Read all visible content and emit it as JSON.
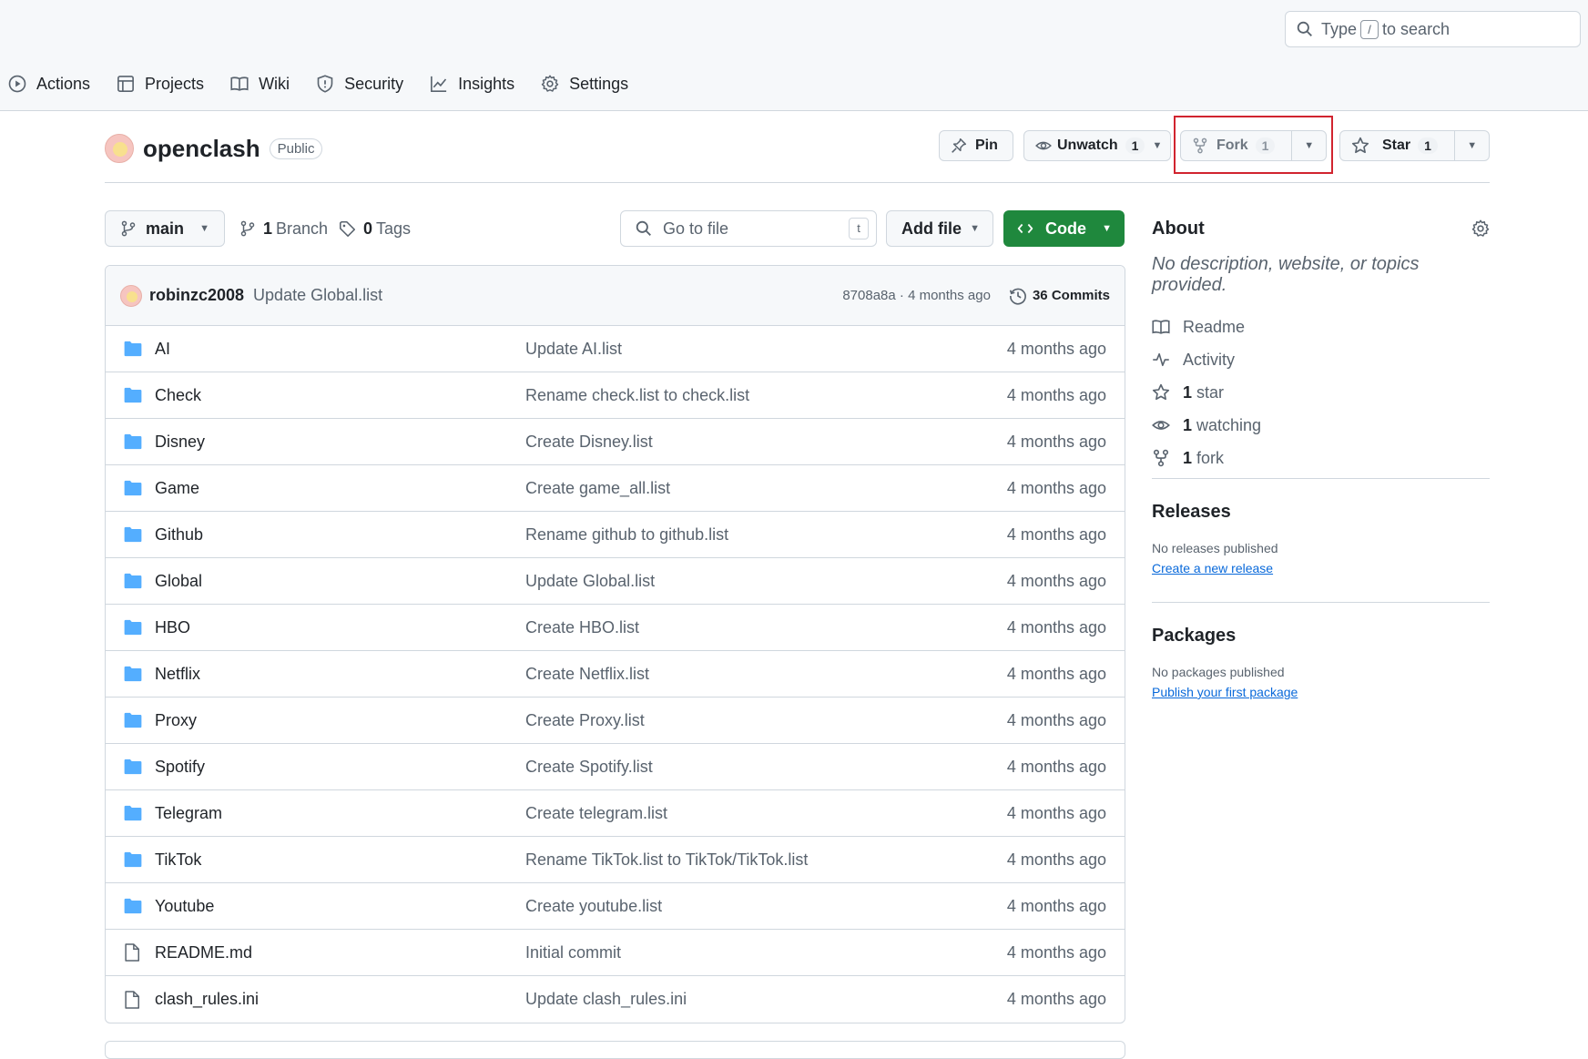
{
  "search": {
    "prefix": "Type",
    "key": "/",
    "suffix": "to search"
  },
  "nav": {
    "tabs": [
      {
        "label": "Actions",
        "icon": "play-icon"
      },
      {
        "label": "Projects",
        "icon": "table-icon"
      },
      {
        "label": "Wiki",
        "icon": "book-icon"
      },
      {
        "label": "Security",
        "icon": "shield-icon"
      },
      {
        "label": "Insights",
        "icon": "graph-icon"
      },
      {
        "label": "Settings",
        "icon": "gear-icon"
      }
    ]
  },
  "repo": {
    "name": "openclash",
    "visibility": "Public"
  },
  "actions": {
    "pin": "Pin",
    "unwatch": {
      "label": "Unwatch",
      "count": "1"
    },
    "fork": {
      "label": "Fork",
      "count": "1"
    },
    "star": {
      "label": "Star",
      "count": "1"
    }
  },
  "toolbar": {
    "branch": "main",
    "branches": {
      "count": "1",
      "label": "Branch"
    },
    "tags": {
      "count": "0",
      "label": "Tags"
    },
    "goto_placeholder": "Go to file",
    "goto_key": "t",
    "add_file": "Add file",
    "code": "Code"
  },
  "latest_commit": {
    "author": "robinzc2008",
    "message": "Update Global.list",
    "sha_time": "8708a8a · 4 months ago",
    "commits": "36 Commits"
  },
  "files": [
    {
      "type": "folder",
      "name": "AI",
      "message": "Update AI.list",
      "age": "4 months ago"
    },
    {
      "type": "folder",
      "name": "Check",
      "message": "Rename check.list to check.list",
      "age": "4 months ago"
    },
    {
      "type": "folder",
      "name": "Disney",
      "message": "Create Disney.list",
      "age": "4 months ago"
    },
    {
      "type": "folder",
      "name": "Game",
      "message": "Create game_all.list",
      "age": "4 months ago"
    },
    {
      "type": "folder",
      "name": "Github",
      "message": "Rename github to github.list",
      "age": "4 months ago"
    },
    {
      "type": "folder",
      "name": "Global",
      "message": "Update Global.list",
      "age": "4 months ago"
    },
    {
      "type": "folder",
      "name": "HBO",
      "message": "Create HBO.list",
      "age": "4 months ago"
    },
    {
      "type": "folder",
      "name": "Netflix",
      "message": "Create Netflix.list",
      "age": "4 months ago"
    },
    {
      "type": "folder",
      "name": "Proxy",
      "message": "Create Proxy.list",
      "age": "4 months ago"
    },
    {
      "type": "folder",
      "name": "Spotify",
      "message": "Create Spotify.list",
      "age": "4 months ago"
    },
    {
      "type": "folder",
      "name": "Telegram",
      "message": "Create telegram.list",
      "age": "4 months ago"
    },
    {
      "type": "folder",
      "name": "TikTok",
      "message": "Rename TikTok.list to TikTok/TikTok.list",
      "age": "4 months ago"
    },
    {
      "type": "folder",
      "name": "Youtube",
      "message": "Create youtube.list",
      "age": "4 months ago"
    },
    {
      "type": "file",
      "name": "README.md",
      "message": "Initial commit",
      "age": "4 months ago"
    },
    {
      "type": "file",
      "name": "clash_rules.ini",
      "message": "Update clash_rules.ini",
      "age": "4 months ago"
    }
  ],
  "about": {
    "title": "About",
    "description": "No description, website, or topics provided.",
    "readme": "Readme",
    "activity": "Activity",
    "stars": {
      "count": "1",
      "label": "star"
    },
    "watching": {
      "count": "1",
      "label": "watching"
    },
    "forks": {
      "count": "1",
      "label": "fork"
    }
  },
  "releases": {
    "title": "Releases",
    "empty": "No releases published",
    "link": "Create a new release"
  },
  "packages": {
    "title": "Packages",
    "empty": "No packages published",
    "link": "Publish your first package"
  },
  "colors": {
    "accent": "#1f883d",
    "link": "#0969da",
    "folder": "#54aeff",
    "highlight": "#d1242f"
  }
}
